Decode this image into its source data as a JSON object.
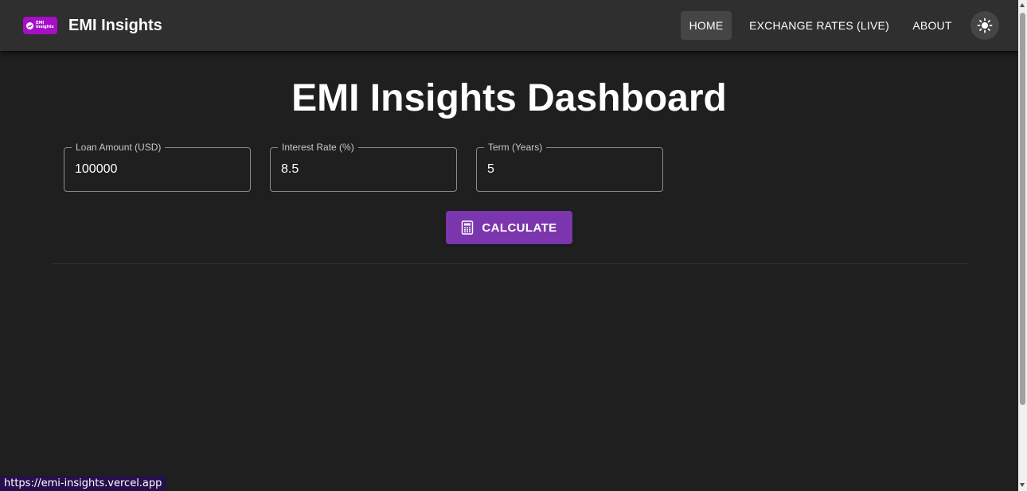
{
  "app": {
    "logo_text": "EMI\nInsights",
    "brand": "EMI Insights"
  },
  "nav": {
    "items": [
      {
        "label": "HOME",
        "active": true
      },
      {
        "label": "EXCHANGE RATES (LIVE)",
        "active": false
      },
      {
        "label": "ABOUT",
        "active": false
      }
    ],
    "theme_toggle_icon": "sun-icon"
  },
  "main": {
    "title": "EMI Insights Dashboard",
    "fields": [
      {
        "label": "Loan Amount (USD)",
        "value": "100000"
      },
      {
        "label": "Interest Rate (%)",
        "value": "8.5"
      },
      {
        "label": "Term (Years)",
        "value": "5"
      }
    ],
    "calculate_label": "CALCULATE",
    "calculate_icon": "calculator-icon"
  },
  "status_bar": {
    "url": "https://emi-insights.vercel.app"
  },
  "colors": {
    "background": "#1f1f1f",
    "appbar": "#2f2f2f",
    "accent": "#7b36ad",
    "logo": "#a60fc7"
  }
}
